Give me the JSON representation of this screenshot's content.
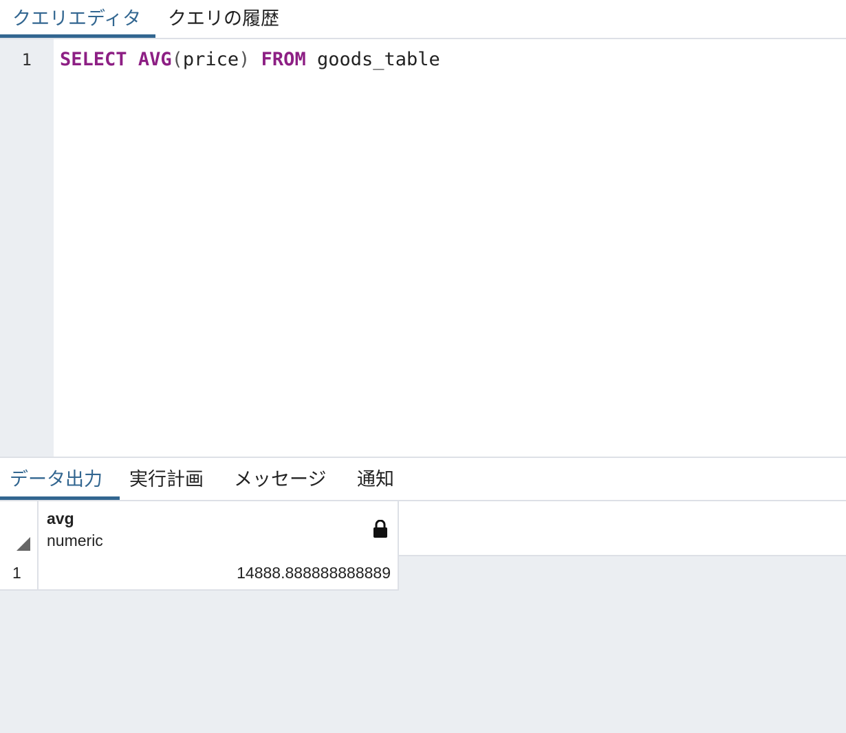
{
  "top_tabs": [
    {
      "label": "クエリエディタ",
      "active": true
    },
    {
      "label": "クエリの履歴",
      "active": false
    }
  ],
  "editor": {
    "line_number": "1",
    "tokens": {
      "select": "SELECT",
      "avg": "AVG",
      "open_paren": "(",
      "column": "price",
      "close_paren": ")",
      "from": "FROM",
      "table": "goods_table"
    }
  },
  "bottom_tabs": [
    {
      "label": "データ出力",
      "active": true
    },
    {
      "label": "実行計画",
      "active": false
    },
    {
      "label": "メッセージ",
      "active": false
    },
    {
      "label": "通知",
      "active": false
    }
  ],
  "result_grid": {
    "columns": [
      {
        "name": "avg",
        "type": "numeric",
        "icon": "lock-icon"
      }
    ],
    "rows": [
      {
        "row_number": "1",
        "cells": [
          "14888.888888888889"
        ]
      }
    ]
  },
  "colors": {
    "accent": "#326690",
    "keyword": "#8d1f84",
    "panel_background": "#ebeef2"
  }
}
